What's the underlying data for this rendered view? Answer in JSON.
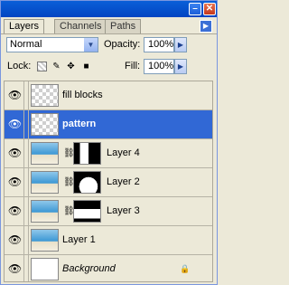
{
  "panel": {
    "tabs": [
      "Layers",
      "Channels",
      "Paths"
    ],
    "blend_mode": "Normal",
    "opacity_label": "Opacity:",
    "opacity_value": "100%",
    "lock_label": "Lock:",
    "fill_label": "Fill:",
    "fill_value": "100%"
  },
  "layers": [
    {
      "name": "fill blocks",
      "style": "normal",
      "selected": false
    },
    {
      "name": "pattern",
      "style": "bold",
      "selected": true
    },
    {
      "name": "Layer 4",
      "style": "normal",
      "selected": false
    },
    {
      "name": "Layer 2",
      "style": "normal",
      "selected": false
    },
    {
      "name": "Layer 3",
      "style": "normal",
      "selected": false
    },
    {
      "name": "Layer 1",
      "style": "normal",
      "selected": false
    },
    {
      "name": "Background",
      "style": "italic",
      "selected": false
    }
  ],
  "colors": {
    "selection": "#3168d5",
    "panel": "#ece9d8"
  }
}
